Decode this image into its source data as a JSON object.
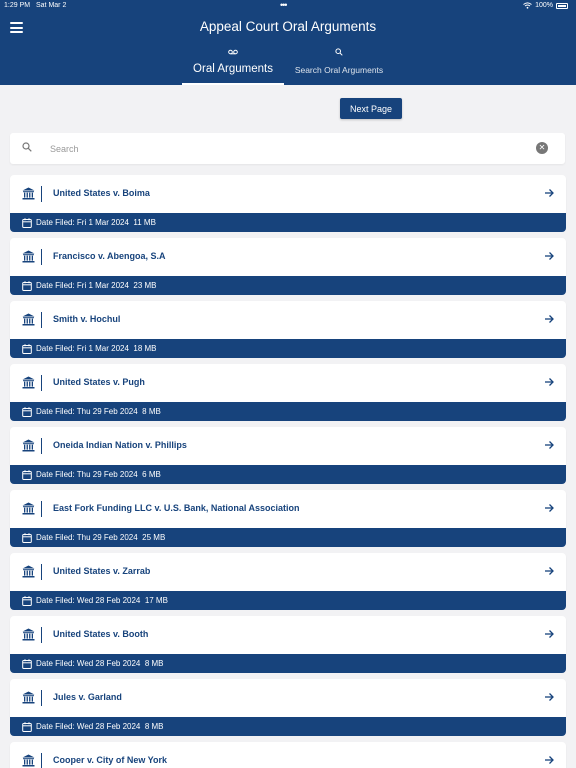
{
  "status": {
    "time": "1:29 PM",
    "date": "Sat Mar 2",
    "battery": "100%"
  },
  "header": {
    "title": "Appeal Court Oral Arguments"
  },
  "tabs": [
    {
      "label": "Oral Arguments",
      "icon": "voicemail-icon",
      "active": true
    },
    {
      "label": "Search Oral Arguments",
      "icon": "search-icon",
      "active": false
    }
  ],
  "toolbar": {
    "next_label": "Next Page"
  },
  "search": {
    "placeholder": "Search",
    "value": ""
  },
  "colors": {
    "primary": "#17437c",
    "background": "#f2f2f4"
  },
  "cases": [
    {
      "title": "United States v. Boima",
      "date": "Date Filed: Fri 1 Mar 2024",
      "size": "11 MB"
    },
    {
      "title": "Francisco v. Abengoa, S.A",
      "date": "Date Filed: Fri 1 Mar 2024",
      "size": "23 MB"
    },
    {
      "title": "Smith v. Hochul",
      "date": "Date Filed: Fri 1 Mar 2024",
      "size": "18 MB"
    },
    {
      "title": "United States v. Pugh",
      "date": "Date Filed: Thu 29 Feb 2024",
      "size": "8 MB"
    },
    {
      "title": "Oneida Indian Nation v. Phillips",
      "date": "Date Filed: Thu 29 Feb 2024",
      "size": "6 MB"
    },
    {
      "title": "East Fork Funding LLC v. U.S. Bank, National Association",
      "date": "Date Filed: Thu 29 Feb 2024",
      "size": "25 MB"
    },
    {
      "title": "United States v. Zarrab",
      "date": "Date Filed: Wed 28 Feb 2024",
      "size": "17 MB"
    },
    {
      "title": "United States v. Booth",
      "date": "Date Filed: Wed 28 Feb 2024",
      "size": "8 MB"
    },
    {
      "title": "Jules v. Garland",
      "date": "Date Filed: Wed 28 Feb 2024",
      "size": "8 MB"
    },
    {
      "title": "Cooper v. City of New York",
      "date": "",
      "size": ""
    }
  ]
}
